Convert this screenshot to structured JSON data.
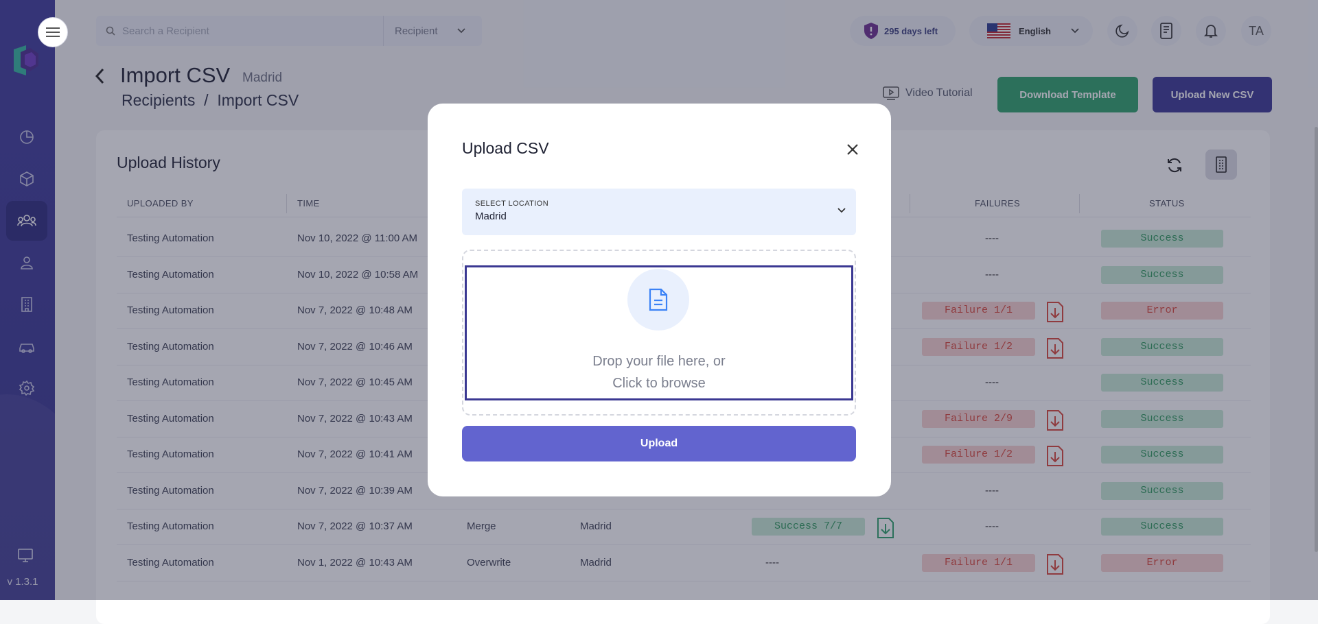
{
  "app": {
    "version": "v 1.3.1"
  },
  "topbar": {
    "search_placeholder": "Search a Recipient",
    "search_filter": "Recipient",
    "trial_text": "295 days left",
    "language": "English",
    "avatar_initials": "TA"
  },
  "header": {
    "title": "Import CSV",
    "subtitle": "Madrid",
    "breadcrumb": "Recipients  /  Import CSV",
    "video_tutorial": "Video Tutorial",
    "download_template": "Download Template",
    "upload_new_csv": "Upload New CSV"
  },
  "table": {
    "title": "Upload History",
    "columns": [
      "UPLOADED BY",
      "TIME",
      "FAILURES",
      "STATUS"
    ],
    "rows": [
      {
        "uploaded_by": "Testing Automation",
        "time": "Nov 10, 2022 @ 11:00 AM",
        "failures": "----",
        "status": "Success",
        "status_type": "ok"
      },
      {
        "uploaded_by": "Testing Automation",
        "time": "Nov 10, 2022 @ 10:58 AM",
        "failures": "----",
        "status": "Success",
        "status_type": "ok"
      },
      {
        "uploaded_by": "Testing Automation",
        "time": "Nov 7, 2022 @ 10:48 AM",
        "failures": "Failure 1/1",
        "status": "Error",
        "status_type": "bad"
      },
      {
        "uploaded_by": "Testing Automation",
        "time": "Nov 7, 2022 @ 10:46 AM",
        "failures": "Failure 1/2",
        "status": "Success",
        "status_type": "ok"
      },
      {
        "uploaded_by": "Testing Automation",
        "time": "Nov 7, 2022 @ 10:45 AM",
        "failures": "----",
        "status": "Success",
        "status_type": "ok"
      },
      {
        "uploaded_by": "Testing Automation",
        "time": "Nov 7, 2022 @ 10:43 AM",
        "failures": "Failure 2/9",
        "status": "Success",
        "status_type": "ok"
      },
      {
        "uploaded_by": "Testing Automation",
        "time": "Nov 7, 2022 @ 10:41 AM",
        "failures": "Failure 1/2",
        "status": "Success",
        "status_type": "ok"
      },
      {
        "uploaded_by": "Testing Automation",
        "time": "Nov 7, 2022 @ 10:39 AM",
        "failures": "----",
        "status": "Success",
        "status_type": "ok"
      },
      {
        "uploaded_by": "Testing Automation",
        "time": "Nov 7, 2022 @ 10:37 AM",
        "type": "Merge",
        "location": "Madrid",
        "success": "Success 7/7",
        "failures": "----",
        "status": "Success",
        "status_type": "ok"
      },
      {
        "uploaded_by": "Testing Automation",
        "time": "Nov 1, 2022 @ 10:43 AM",
        "type": "Overwrite",
        "location": "Madrid",
        "success": "----",
        "failures": "Failure 1/1",
        "status": "Error",
        "status_type": "bad"
      }
    ]
  },
  "modal": {
    "title": "Upload CSV",
    "location_label": "SELECT LOCATION",
    "location_value": "Madrid",
    "drop_line1": "Drop your file here, or",
    "drop_line2": "Click to browse",
    "upload_button": "Upload"
  },
  "colors": {
    "sidebar": "#3f3c9c",
    "primary": "#3b3794",
    "success": "#2fa36b",
    "error": "#d9473b",
    "upload_button": "#6264cf"
  }
}
